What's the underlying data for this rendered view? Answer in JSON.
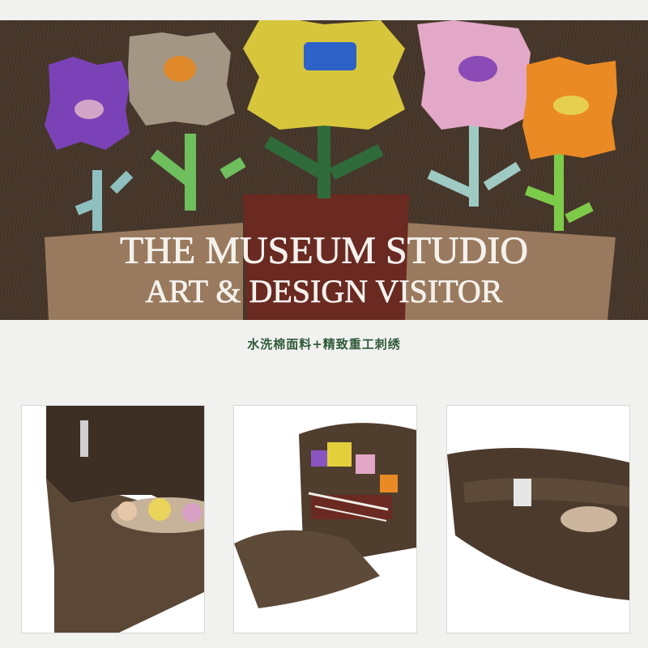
{
  "hero": {
    "line1": "THE MUSEUM STUDIO",
    "line2": "ART & DESIGN VISITOR"
  },
  "caption": "水洗棉面料+精致重工刺绣",
  "thumbs": [
    {
      "view": "cap-underside"
    },
    {
      "view": "cap-front"
    },
    {
      "view": "cap-back-strap"
    }
  ],
  "colors": {
    "cap_brown": "#4a3a2c",
    "caption_green": "#2f5a3a"
  }
}
